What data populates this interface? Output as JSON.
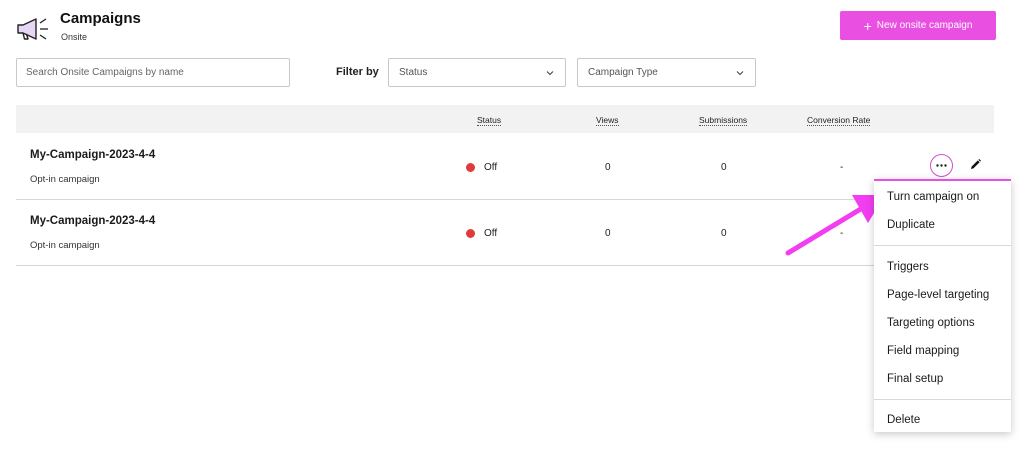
{
  "header": {
    "title": "Campaigns",
    "subtitle": "Onsite",
    "logo_icon": "megaphone-icon",
    "new_button_label": "New onsite campaign",
    "new_button_icon": "plus-icon"
  },
  "toolbar": {
    "search_placeholder": "Search Onsite Campaigns by name",
    "filter_label": "Filter by",
    "status_select": "Status",
    "type_select": "Campaign Type"
  },
  "table": {
    "columns": [
      "Status",
      "Views",
      "Submissions",
      "Conversion Rate"
    ],
    "rows": [
      {
        "name": "My-Campaign-2023-4-4",
        "type": "Opt-in campaign",
        "status": "Off",
        "views": "0",
        "submissions": "0",
        "conversion_rate": "-"
      },
      {
        "name": "My-Campaign-2023-4-4",
        "type": "Opt-in campaign",
        "status": "Off",
        "views": "0",
        "submissions": "0",
        "conversion_rate": "-"
      }
    ]
  },
  "menu": {
    "items": [
      "Turn campaign on",
      "Duplicate",
      "Triggers",
      "Page-level targeting",
      "Targeting options",
      "Field mapping",
      "Final setup",
      "Delete"
    ]
  },
  "colors": {
    "accent": "#e94fe0",
    "status_off": "#e03b3b",
    "header_bg": "#f2f2f2"
  }
}
